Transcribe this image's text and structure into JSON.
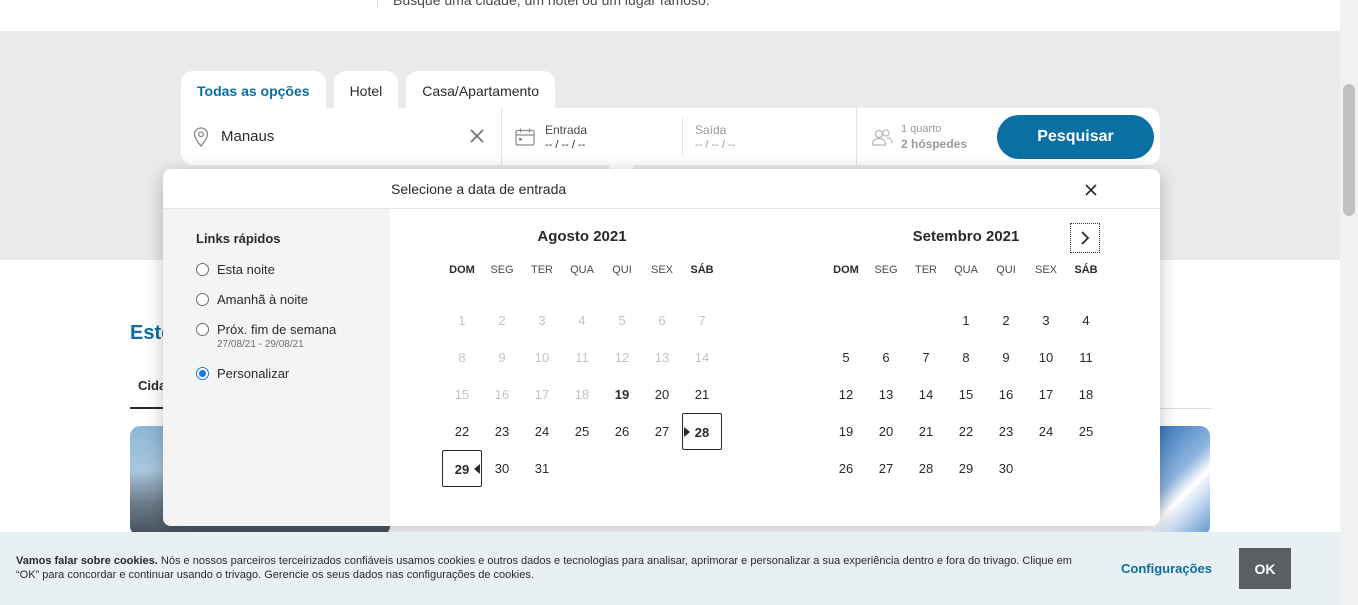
{
  "top": {
    "hint": "Busque uma cidade, um hotel ou um lugar famoso."
  },
  "tabs": [
    {
      "label": "Todas as opções",
      "active": true
    },
    {
      "label": "Hotel",
      "active": false
    },
    {
      "label": "Casa/Apartamento",
      "active": false
    }
  ],
  "search": {
    "location_value": "Manaus",
    "checkin_label": "Entrada",
    "checkin_value": "-- / -- / --",
    "checkout_label": "Saída",
    "checkout_value": "-- / -- / --",
    "rooms": "1 quarto",
    "guests": "2 hóspedes",
    "button": "Pesquisar"
  },
  "background": {
    "section_title": "Este",
    "tab": "Cida"
  },
  "datepicker": {
    "title": "Selecione a data de entrada",
    "quick_links_title": "Links rápidos",
    "quick_links": [
      {
        "label": "Esta noite",
        "sub": "",
        "checked": false
      },
      {
        "label": "Amanhã à noite",
        "sub": "",
        "checked": false
      },
      {
        "label": "Próx. fim de semana",
        "sub": "27/08/21 - 29/08/21",
        "checked": false
      },
      {
        "label": "Personalizar",
        "sub": "",
        "checked": true
      }
    ],
    "weekdays": [
      "DOM",
      "SEG",
      "TER",
      "QUA",
      "QUI",
      "SEX",
      "SÁB"
    ],
    "months": [
      {
        "title": "Agosto 2021",
        "first_weekday": 0,
        "days": 31,
        "disabled_until": 18,
        "today": 19,
        "selected_start": 28,
        "selected_end": 29
      },
      {
        "title": "Setembro 2021",
        "first_weekday": 3,
        "days": 30,
        "disabled_until": 0,
        "today": null,
        "selected_start": null,
        "selected_end": null
      }
    ]
  },
  "cookie": {
    "bold": "Vamos falar sobre cookies.",
    "text": " Nós e nossos parceiros terceirizados confiáveis usamos cookies e outros dados e tecnologias para analisar, aprimorar e personalizar a sua experiência dentro e fora do trivago. Clique em “OK” para concordar e continuar usando o trivago. Gerencie os seus dados nas configurações de cookies.",
    "settings": "Configurações",
    "ok": "OK"
  },
  "colors": {
    "brand": "#0a6fa3",
    "hero_bg": "#ebebeb",
    "cookie_bg": "#e8f0f3"
  }
}
